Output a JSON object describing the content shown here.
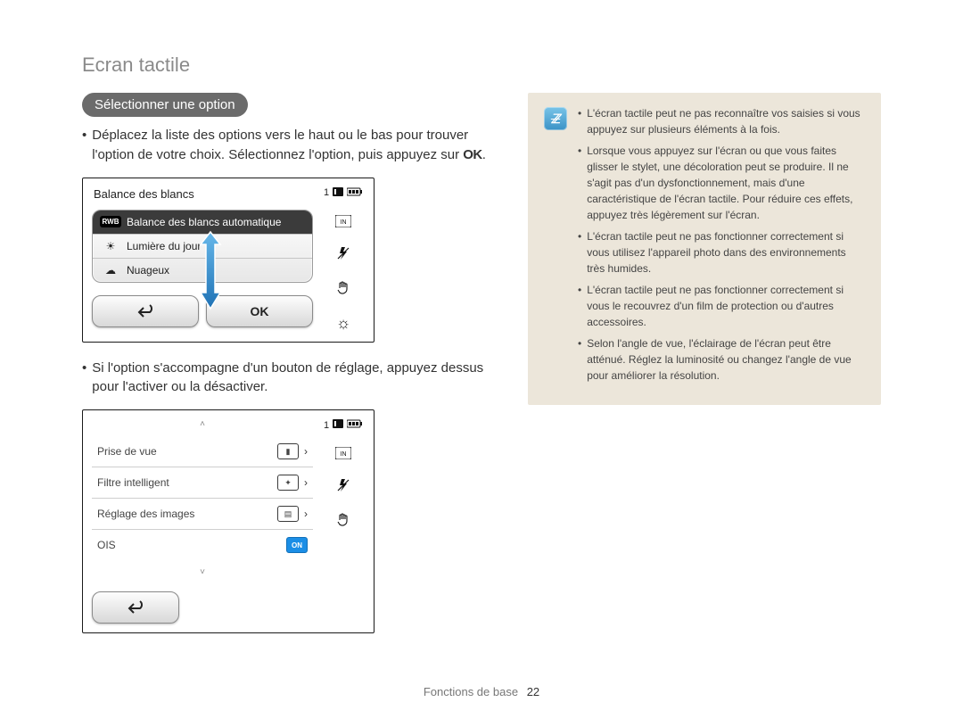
{
  "page_title": "Ecran tactile",
  "footer": {
    "section": "Fonctions de base",
    "page": "22"
  },
  "section_heading": "Sélectionner une option",
  "paragraph1_prefix": "Déplacez la liste des options vers le haut ou le bas pour trouver l'option de votre choix. Sélectionnez l'option, puis appuyez sur ",
  "paragraph1_ok": "OK",
  "paragraph1_suffix": ".",
  "mock1": {
    "header": "Balance des blancs",
    "status_count": "1",
    "items": [
      {
        "icon": "RWB",
        "label": "Balance des blancs automatique"
      },
      {
        "icon": "sun",
        "label": "Lumière du jour"
      },
      {
        "icon": "cloud",
        "label": "Nuageux"
      }
    ],
    "back_label": "↩",
    "ok_label": "OK",
    "side_icons": [
      "storage",
      "card",
      "flash-off",
      "steady-hand",
      "brightness"
    ]
  },
  "paragraph2": "Si l'option s'accompagne d'un bouton de réglage, appuyez dessus pour l'activer ou la désactiver.",
  "mock2": {
    "status_count": "1",
    "rows": [
      {
        "label": "Prise de vue",
        "value_icon": "single-shot",
        "chevron": true
      },
      {
        "label": "Filtre intelligent",
        "value_icon": "smart-filter",
        "chevron": true
      },
      {
        "label": "Réglage des images",
        "value_icon": "image-adj",
        "chevron": true
      },
      {
        "label": "OIS",
        "value_text": "ON",
        "chevron": false
      }
    ],
    "scroll_up": "˄",
    "scroll_down": "˅",
    "back_label": "↩",
    "side_icons": [
      "storage",
      "card",
      "flash-off",
      "steady-hand"
    ]
  },
  "info_notes": [
    "L'écran tactile peut ne pas reconnaître vos saisies si vous appuyez sur plusieurs éléments à la fois.",
    "Lorsque vous appuyez sur l'écran ou que vous faites glisser le stylet, une décoloration peut se produire. Il ne s'agit pas d'un dysfonctionnement, mais d'une caractéristique de l'écran tactile. Pour réduire ces effets, appuyez très légèrement sur l'écran.",
    "L'écran tactile peut ne pas fonctionner correctement si vous utilisez l'appareil photo dans des environnements très humides.",
    "L'écran tactile peut ne pas fonctionner correctement si vous le recouvrez d'un film de protection ou d'autres accessoires.",
    "Selon l'angle de vue, l'éclairage de l'écran peut être atténué. Réglez la luminosité ou changez l'angle de vue pour améliorer la résolution."
  ]
}
